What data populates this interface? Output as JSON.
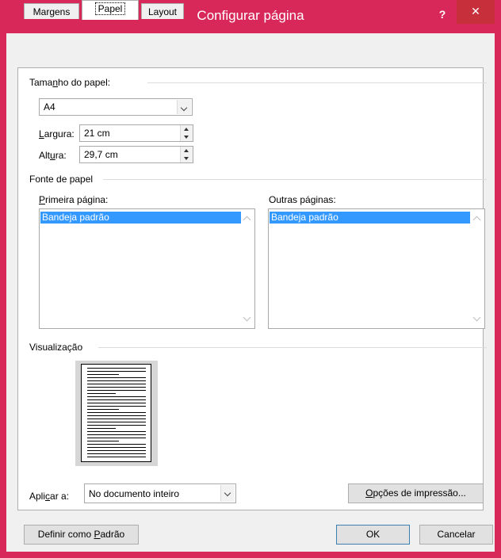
{
  "window": {
    "title": "Configurar página",
    "help": "?",
    "close": "✕"
  },
  "tabs": [
    {
      "label": "Margens"
    },
    {
      "label": "Papel"
    },
    {
      "label": "Layout"
    }
  ],
  "paper_size": {
    "group_title_a": "Tama",
    "group_title_u": "n",
    "group_title_b": "ho do papel:",
    "size_value": "A4",
    "width_label_u": "L",
    "width_label_b": "argura:",
    "width_value": "21 cm",
    "height_label_a": "Alt",
    "height_label_u": "u",
    "height_label_b": "ra:",
    "height_value": "29,7 cm"
  },
  "paper_source": {
    "group_title": "Fonte de papel",
    "first_page_label_u": "P",
    "first_page_label_b": "rimeira página:",
    "first_page_item": "Bandeja padrão",
    "other_pages_label_a": "Outras páginas:",
    "other_pages_item": "Bandeja padrão"
  },
  "preview": {
    "group_title": "Visualização"
  },
  "apply": {
    "label_a": "Apli",
    "label_u": "c",
    "label_b": "ar a:",
    "value": "No documento inteiro"
  },
  "buttons": {
    "print_options_u": "O",
    "print_options_b": "pções de impressão...",
    "set_default_a": "Definir como ",
    "set_default_u": "P",
    "set_default_b": "adrão",
    "ok": "OK",
    "cancel": "Cancelar"
  },
  "colors": {
    "accent": "#d8285a",
    "selection": "#3399ff",
    "close": "#c7303b"
  }
}
